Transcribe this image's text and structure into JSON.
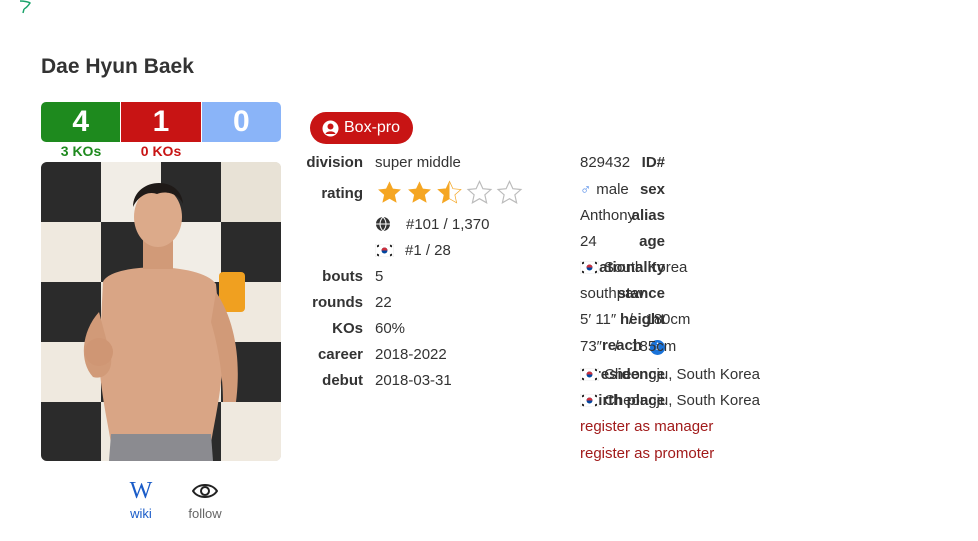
{
  "page": {
    "corner_icon": "leaf-icon"
  },
  "boxer": {
    "name": "Dae Hyun Baek"
  },
  "record": {
    "wins": "4",
    "losses": "1",
    "draws": "0",
    "wins_ko": "3 KOs",
    "losses_ko": "0 KOs"
  },
  "colors": {
    "win": "#1e8a1e",
    "loss": "#c81414",
    "draw": "#8ab4f8",
    "link": "#a11a1a"
  },
  "badge": {
    "label": "Box-pro",
    "icon": "user-circle-icon"
  },
  "left_info": {
    "division": {
      "label": "division",
      "value": "super middle"
    },
    "rating": {
      "label": "rating",
      "stars": 2.5,
      "max_stars": 5,
      "world_rank": "#101 / 1,370",
      "national_rank": "#1 / 28"
    },
    "bouts": {
      "label": "bouts",
      "value": "5"
    },
    "rounds": {
      "label": "rounds",
      "value": "22"
    },
    "kos": {
      "label": "KOs",
      "value": "60%"
    },
    "career": {
      "label": "career",
      "value": "2018-2022"
    },
    "debut": {
      "label": "debut",
      "value": "2018-03-31"
    }
  },
  "right_info": {
    "id": {
      "label": "ID#",
      "value": "829432"
    },
    "sex": {
      "label": "sex",
      "symbol": "♂",
      "value": "male"
    },
    "alias": {
      "label": "alias",
      "value": "Anthony"
    },
    "age": {
      "label": "age",
      "value": "24"
    },
    "nationality": {
      "label": "nationality",
      "value": "South Korea"
    },
    "stance": {
      "label": "stance",
      "value": "southpaw"
    },
    "height": {
      "label": "height",
      "value": "5′ 11″   /   180cm"
    },
    "reach": {
      "label": "reach",
      "value": "73″   /   185cm"
    },
    "residence": {
      "label": "residence",
      "value": "Cheongju, South Korea"
    },
    "birth_place": {
      "label": "birth place",
      "value": "Cheongju, South Korea"
    },
    "register_manager": "register as manager",
    "register_promoter": "register as promoter"
  },
  "actions": {
    "wiki_glyph": "W",
    "wiki": "wiki",
    "follow": "follow"
  }
}
